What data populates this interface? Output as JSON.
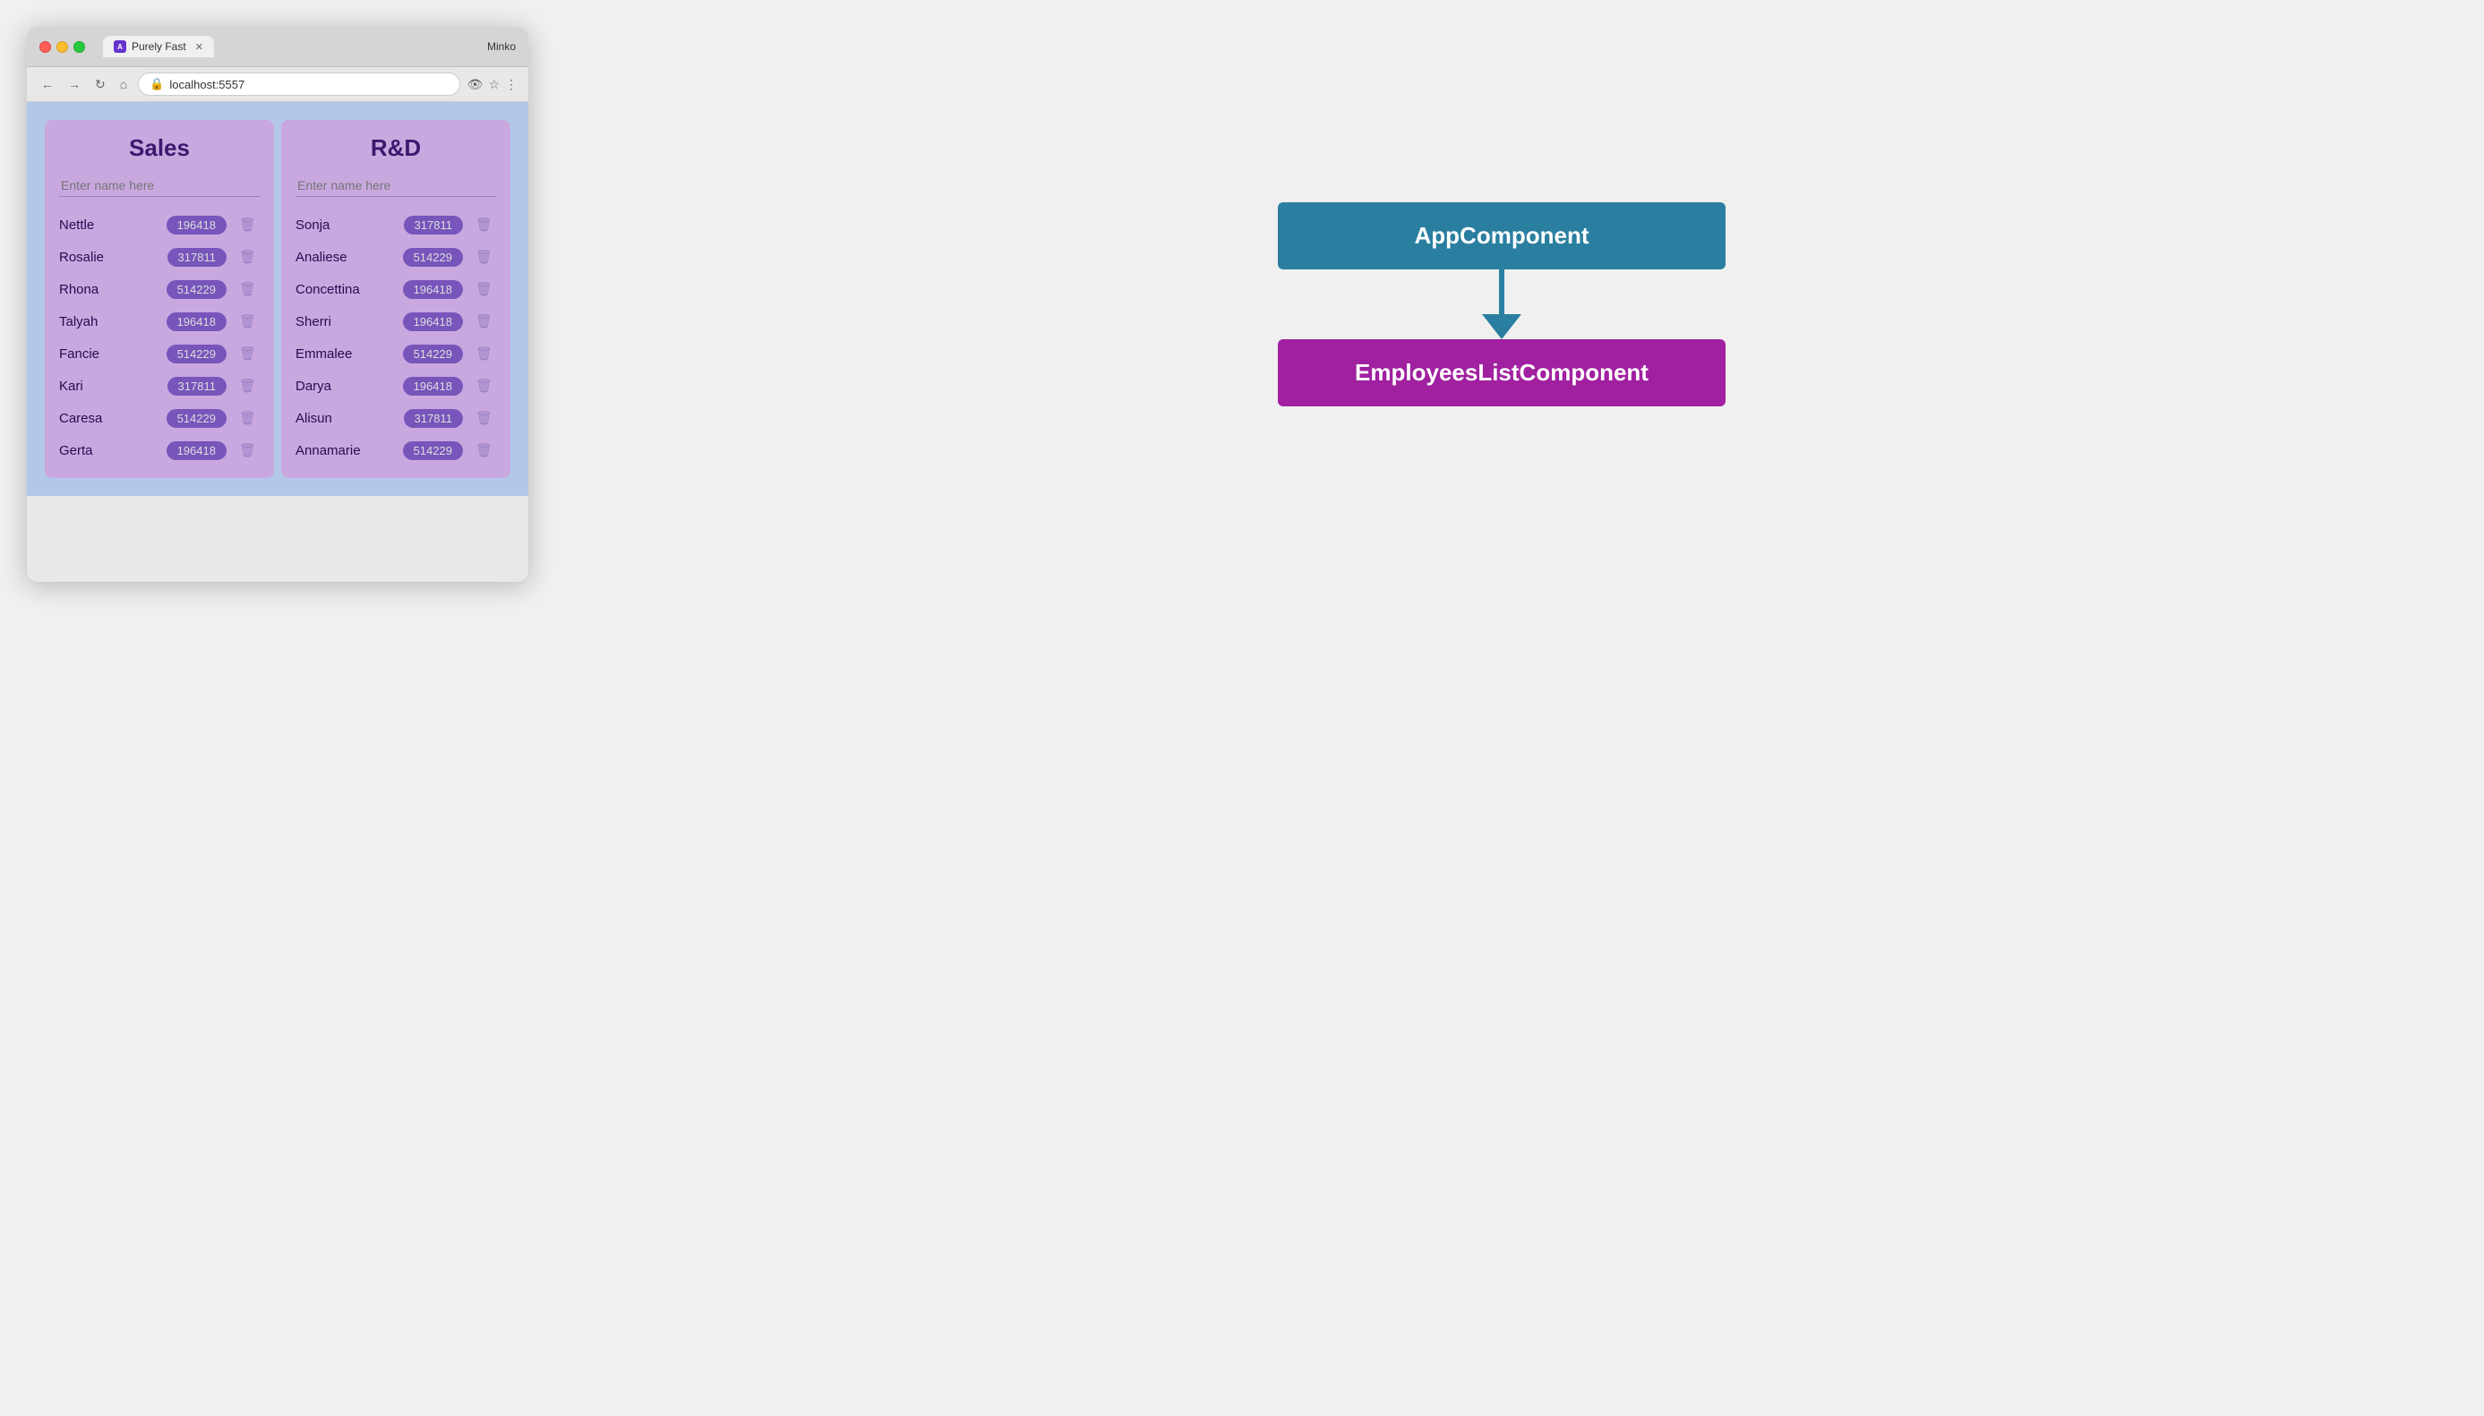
{
  "browser": {
    "tab_title": "Purely Fast",
    "tab_favicon": "A",
    "url": "localhost:5557",
    "user": "Minko"
  },
  "nav": {
    "back": "←",
    "forward": "→",
    "refresh": "↻",
    "home": "⌂"
  },
  "toolbar": {
    "eye_icon": "👁",
    "star_icon": "☆",
    "menu_icon": "⋮"
  },
  "sales": {
    "title": "Sales",
    "input_placeholder": "Enter name here",
    "employees": [
      {
        "name": "Nettle",
        "badge": "196418"
      },
      {
        "name": "Rosalie",
        "badge": "317811"
      },
      {
        "name": "Rhona",
        "badge": "514229"
      },
      {
        "name": "Talyah",
        "badge": "196418"
      },
      {
        "name": "Fancie",
        "badge": "514229"
      },
      {
        "name": "Kari",
        "badge": "317811"
      },
      {
        "name": "Caresa",
        "badge": "514229"
      },
      {
        "name": "Gerta",
        "badge": "196418"
      }
    ]
  },
  "rnd": {
    "title": "R&D",
    "input_placeholder": "Enter name here",
    "employees": [
      {
        "name": "Sonja",
        "badge": "317811"
      },
      {
        "name": "Analiese",
        "badge": "514229"
      },
      {
        "name": "Concettina",
        "badge": "196418"
      },
      {
        "name": "Sherri",
        "badge": "196418"
      },
      {
        "name": "Emmalee",
        "badge": "514229"
      },
      {
        "name": "Darya",
        "badge": "196418"
      },
      {
        "name": "Alisun",
        "badge": "317811"
      },
      {
        "name": "Annamarie",
        "badge": "514229"
      }
    ]
  },
  "diagram": {
    "app_component_label": "AppComponent",
    "employees_component_label": "EmployeesListComponent"
  }
}
